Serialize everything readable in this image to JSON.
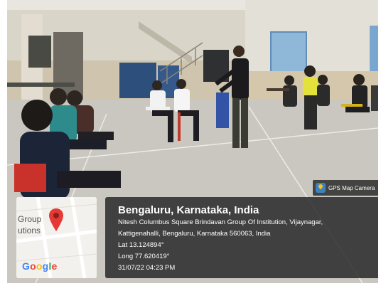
{
  "gps_badge": {
    "label": "GPS Map Camera",
    "icon": "map-pin-icon"
  },
  "map": {
    "label_line1": "Group",
    "label_line2": "utions",
    "logo_text": "Google",
    "logo_colors": [
      "#4285F4",
      "#EA4335",
      "#FBBC05",
      "#4285F4",
      "#34A853",
      "#EA4335"
    ],
    "pin_color": "#E53935"
  },
  "location": {
    "title": "Bengaluru, Karnataka, India",
    "address_line1": "Nitesh Columbus Square Brindavan Group Of Institution, Vijaynagar,",
    "address_line2": "Kattigenahalli, Bengaluru, Karnataka 560063, India",
    "lat": "Lat 13.124894°",
    "long": "Long 77.620419°",
    "datetime": "31/07/22 04:23 PM"
  }
}
